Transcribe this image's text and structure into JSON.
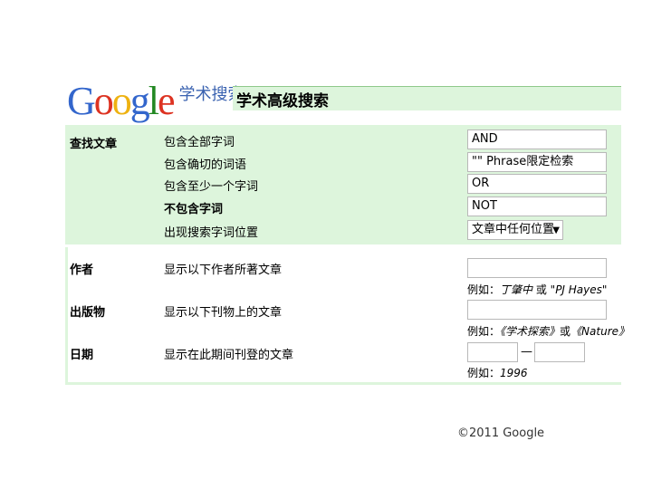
{
  "logo": {
    "brand": "Google",
    "product": "学术搜索"
  },
  "page_title": "学术高级搜索",
  "find_section": {
    "label": "查找文章",
    "rows": [
      {
        "label": "包含全部字词",
        "value": "AND",
        "bold": false
      },
      {
        "label": "包含确切的词语",
        "value": "\"\" Phrase限定检索",
        "bold": false
      },
      {
        "label": "包含至少一个字词",
        "value": "OR",
        "bold": false
      },
      {
        "label": "不包含字词",
        "value": "NOT",
        "bold": true
      },
      {
        "label": "出现搜索字词位置",
        "value": "文章中任何位置",
        "bold": false
      }
    ]
  },
  "author_section": {
    "label": "作者",
    "description": "显示以下作者所著文章",
    "hint_prefix": "例如：",
    "hint_example1": "丁肇中",
    "hint_or": " 或 ",
    "hint_example2": "\"PJ Hayes\""
  },
  "publication_section": {
    "label": "出版物",
    "description": "显示以下刊物上的文章",
    "hint_prefix": "例如：",
    "hint_example1": "《学术探索》",
    "hint_or": "或",
    "hint_example2": "《Nature》"
  },
  "date_section": {
    "label": "日期",
    "description": "显示在此期间刊登的文章",
    "separator": "—",
    "hint_prefix": "例如：",
    "hint_example": "1996"
  },
  "footer": {
    "copyright": "©2011 Google"
  },
  "colors": {
    "panel_green": "#ddf5dc",
    "border_green": "#8fc98a"
  }
}
